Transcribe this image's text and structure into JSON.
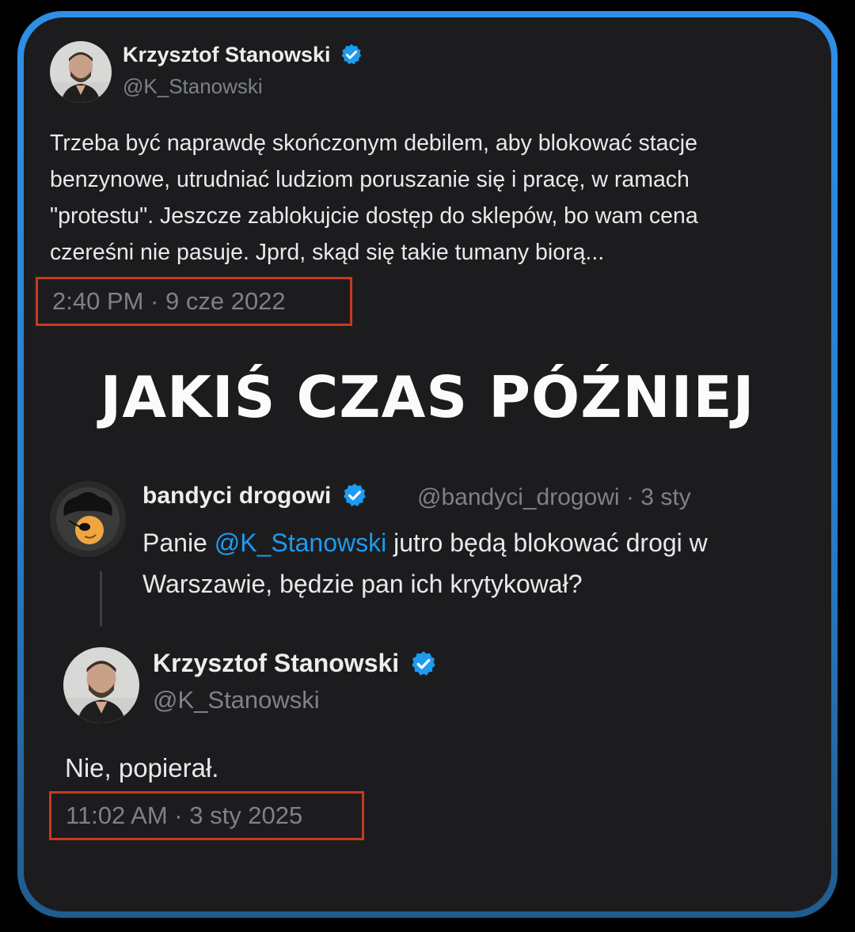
{
  "tweet1": {
    "author_name": "Krzysztof Stanowski",
    "author_handle": "@K_Stanowski",
    "text_lines": [
      "Trzeba być naprawdę skończonym debilem, aby blokować stacje",
      "benzynowe, utrudniać ludziom poruszanie się i pracę, w ramach",
      "\"protestu\". Jeszcze zablokujcie dostęp do sklepów, bo wam cena",
      "czereśni nie pasuje. Jprd, skąd się takie tumany biorą..."
    ],
    "timestamp": "2:40 PM · 9 cze 2022"
  },
  "headline": "JAKIŚ CZAS PÓŹNIEJ",
  "reply_parent": {
    "author_name": "bandyci drogowi",
    "author_handle": "@bandyci_drogowi",
    "separator": "·",
    "date": "3 sty",
    "text_prefix": "Panie ",
    "mention": "@K_Stanowski",
    "text_suffix": " jutro będą blokować drogi w",
    "text_line2": "Warszawie, będzie pan ich krytykował?"
  },
  "tweet2": {
    "author_name": "Krzysztof Stanowski",
    "author_handle": "@K_Stanowski",
    "text": "Nie, popierał.",
    "timestamp": "11:02 AM · 3 sty 2025"
  },
  "colors": {
    "frame_accent": "#2f8fe8",
    "verified_badge": "#1d9bf0",
    "mention": "#1d9bf0",
    "timestamp_highlight": "#c8391f"
  },
  "icons": {
    "verified": "verified-badge-icon"
  }
}
